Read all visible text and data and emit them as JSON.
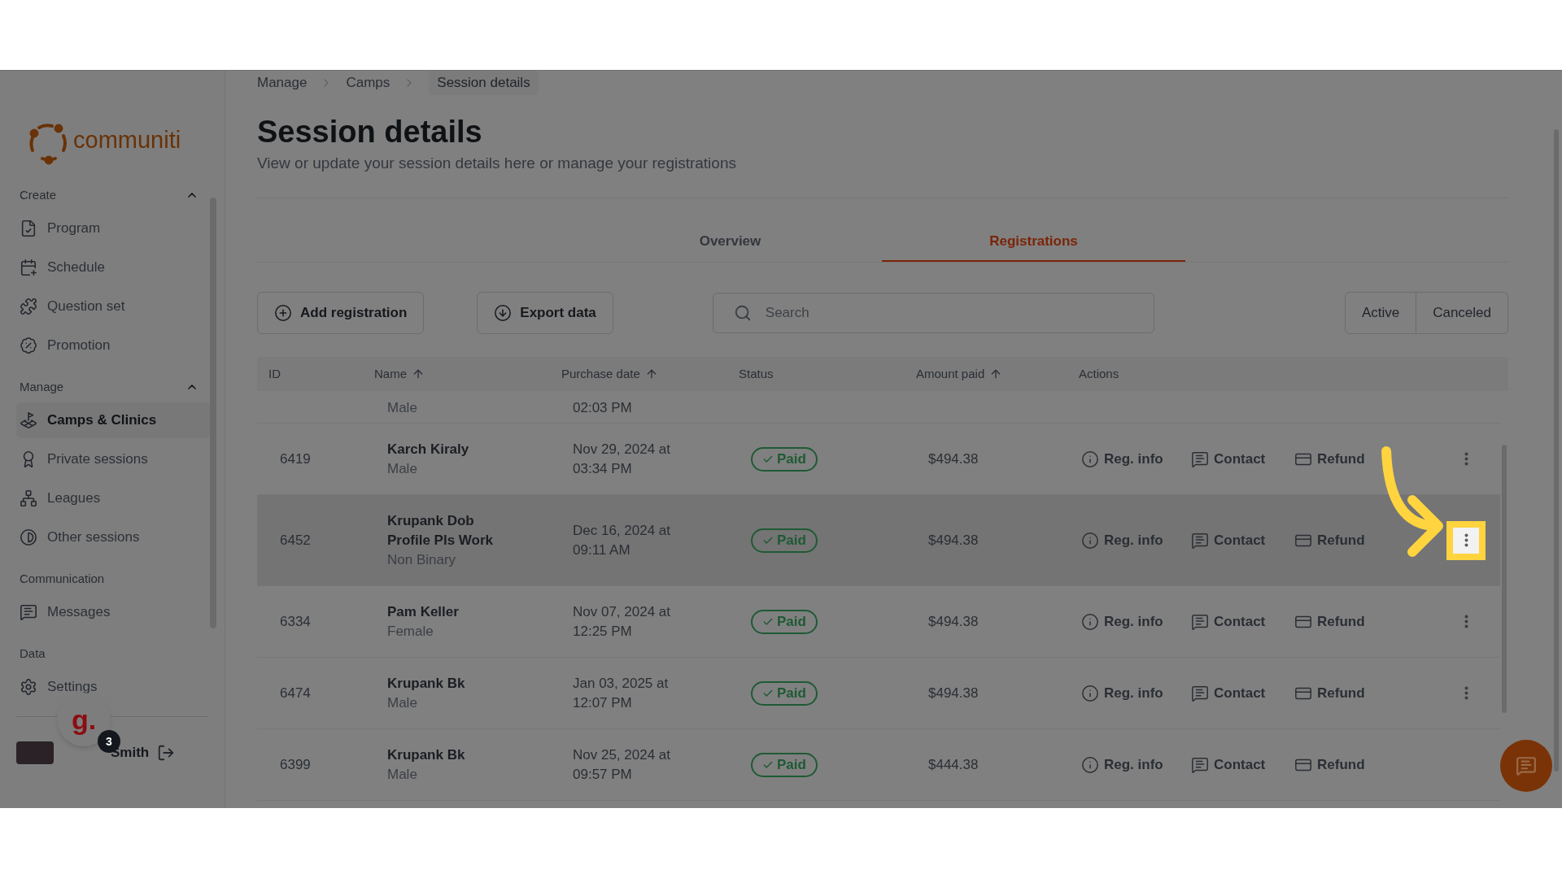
{
  "sidebar": {
    "logo": "communiti",
    "sections": [
      {
        "title": "Create",
        "expanded": true,
        "items": [
          {
            "label": "Program",
            "selected": false
          },
          {
            "label": "Schedule",
            "selected": false
          },
          {
            "label": "Question set",
            "selected": false
          },
          {
            "label": "Promotion",
            "selected": false
          }
        ]
      },
      {
        "title": "Manage",
        "expanded": true,
        "items": [
          {
            "label": "Camps & Clinics",
            "selected": true
          },
          {
            "label": "Private sessions",
            "selected": false
          },
          {
            "label": "Leagues",
            "selected": false
          },
          {
            "label": "Other sessions",
            "selected": false
          }
        ]
      },
      {
        "title": "Communication",
        "items": [
          {
            "label": "Messages",
            "selected": false
          }
        ]
      },
      {
        "title": "Data",
        "items": [
          {
            "label": "Settings",
            "selected": false
          }
        ]
      }
    ],
    "user": {
      "name": "Smith"
    },
    "widget": {
      "label": "g.",
      "badge": "3"
    }
  },
  "breadcrumbs": [
    "Manage",
    "Camps",
    "Session details"
  ],
  "page": {
    "title": "Session details",
    "subtitle": "View or update your session details here or manage your registrations"
  },
  "tabs": [
    {
      "label": "Overview",
      "selected": false
    },
    {
      "label": "Registrations",
      "selected": true
    }
  ],
  "toolbar": {
    "add_button": "Add registration",
    "export_button": "Export data",
    "search": {
      "placeholder": "Search"
    },
    "filters": [
      "Active",
      "Canceled"
    ]
  },
  "table": {
    "columns": [
      {
        "label": "ID",
        "sortable": false
      },
      {
        "label": "Name",
        "sortable": true
      },
      {
        "label": "Purchase date",
        "sortable": true
      },
      {
        "label": "Status",
        "sortable": false
      },
      {
        "label": "Amount paid",
        "sortable": true
      },
      {
        "label": "Actions",
        "sortable": false
      }
    ],
    "rows": [
      {
        "kind": "partial",
        "gender": "Male",
        "purchase_time": "02:03 PM"
      },
      {
        "kind": "full",
        "id": "6419",
        "name": "Karch Kiraly",
        "gender": "Male",
        "purchase_date": "Nov 29, 2024 at",
        "purchase_time": "03:34 PM",
        "status": {
          "label": "Paid",
          "kind": "paid"
        },
        "amount": "$494.38",
        "actions": [
          "Reg. info",
          "Contact",
          "Refund"
        ],
        "has_menu": true,
        "highlighted": false
      },
      {
        "kind": "full",
        "id": "6452",
        "name": "Krupank Dob Profile Pls Work",
        "gender": "Non Binary",
        "purchase_date": "Dec 16, 2024 at",
        "purchase_time": "09:11 AM",
        "status": {
          "label": "Paid",
          "kind": "paid"
        },
        "amount": "$494.38",
        "actions": [
          "Reg. info",
          "Contact",
          "Refund"
        ],
        "has_menu": true,
        "highlighted": true
      },
      {
        "kind": "full",
        "id": "6334",
        "name": "Pam Keller",
        "gender": "Female",
        "purchase_date": "Nov 07, 2024 at",
        "purchase_time": "12:25 PM",
        "status": {
          "label": "Paid",
          "kind": "paid"
        },
        "amount": "$494.38",
        "actions": [
          "Reg. info",
          "Contact",
          "Refund"
        ],
        "has_menu": true,
        "highlighted": false
      },
      {
        "kind": "full",
        "id": "6474",
        "name": "Krupank Bk",
        "gender": "Male",
        "purchase_date": "Jan 03, 2025 at",
        "purchase_time": "12:07 PM",
        "status": {
          "label": "Paid",
          "kind": "paid"
        },
        "amount": "$494.38",
        "actions": [
          "Reg. info",
          "Contact",
          "Refund"
        ],
        "has_menu": true,
        "highlighted": false
      },
      {
        "kind": "full",
        "id": "6399",
        "name": "Krupank Bk",
        "gender": "Male",
        "purchase_date": "Nov 25, 2024 at",
        "purchase_time": "09:57 PM",
        "status": {
          "label": "Paid",
          "kind": "paid"
        },
        "amount": "$444.38",
        "actions": [
          "Reg. info",
          "Contact",
          "Refund"
        ],
        "has_menu": false,
        "highlighted": false
      }
    ]
  }
}
